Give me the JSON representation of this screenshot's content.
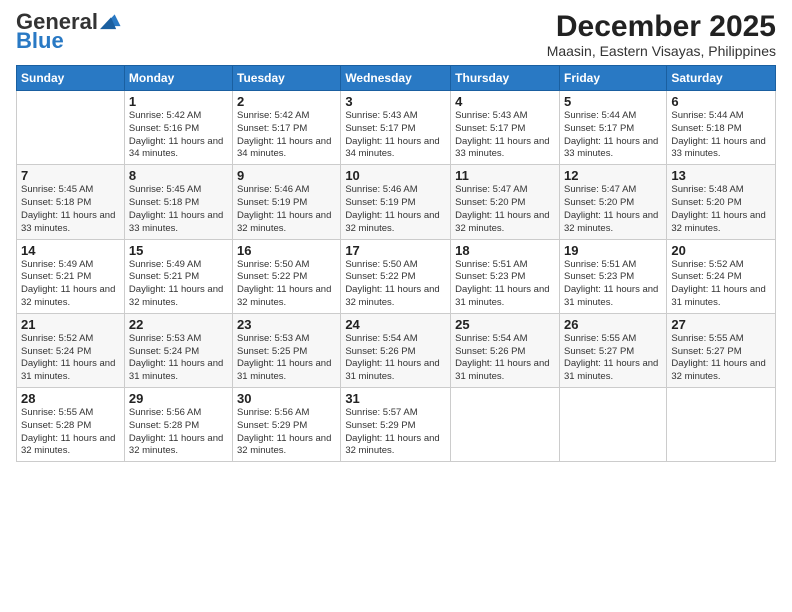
{
  "logo": {
    "general": "General",
    "blue": "Blue"
  },
  "title": "December 2025",
  "subtitle": "Maasin, Eastern Visayas, Philippines",
  "days_header": [
    "Sunday",
    "Monday",
    "Tuesday",
    "Wednesday",
    "Thursday",
    "Friday",
    "Saturday"
  ],
  "weeks": [
    [
      {
        "day": "",
        "info": ""
      },
      {
        "day": "1",
        "info": "Sunrise: 5:42 AM\nSunset: 5:16 PM\nDaylight: 11 hours and 34 minutes."
      },
      {
        "day": "2",
        "info": "Sunrise: 5:42 AM\nSunset: 5:17 PM\nDaylight: 11 hours and 34 minutes."
      },
      {
        "day": "3",
        "info": "Sunrise: 5:43 AM\nSunset: 5:17 PM\nDaylight: 11 hours and 34 minutes."
      },
      {
        "day": "4",
        "info": "Sunrise: 5:43 AM\nSunset: 5:17 PM\nDaylight: 11 hours and 33 minutes."
      },
      {
        "day": "5",
        "info": "Sunrise: 5:44 AM\nSunset: 5:17 PM\nDaylight: 11 hours and 33 minutes."
      },
      {
        "day": "6",
        "info": "Sunrise: 5:44 AM\nSunset: 5:18 PM\nDaylight: 11 hours and 33 minutes."
      }
    ],
    [
      {
        "day": "7",
        "info": "Sunrise: 5:45 AM\nSunset: 5:18 PM\nDaylight: 11 hours and 33 minutes."
      },
      {
        "day": "8",
        "info": "Sunrise: 5:45 AM\nSunset: 5:18 PM\nDaylight: 11 hours and 33 minutes."
      },
      {
        "day": "9",
        "info": "Sunrise: 5:46 AM\nSunset: 5:19 PM\nDaylight: 11 hours and 32 minutes."
      },
      {
        "day": "10",
        "info": "Sunrise: 5:46 AM\nSunset: 5:19 PM\nDaylight: 11 hours and 32 minutes."
      },
      {
        "day": "11",
        "info": "Sunrise: 5:47 AM\nSunset: 5:20 PM\nDaylight: 11 hours and 32 minutes."
      },
      {
        "day": "12",
        "info": "Sunrise: 5:47 AM\nSunset: 5:20 PM\nDaylight: 11 hours and 32 minutes."
      },
      {
        "day": "13",
        "info": "Sunrise: 5:48 AM\nSunset: 5:20 PM\nDaylight: 11 hours and 32 minutes."
      }
    ],
    [
      {
        "day": "14",
        "info": "Sunrise: 5:49 AM\nSunset: 5:21 PM\nDaylight: 11 hours and 32 minutes."
      },
      {
        "day": "15",
        "info": "Sunrise: 5:49 AM\nSunset: 5:21 PM\nDaylight: 11 hours and 32 minutes."
      },
      {
        "day": "16",
        "info": "Sunrise: 5:50 AM\nSunset: 5:22 PM\nDaylight: 11 hours and 32 minutes."
      },
      {
        "day": "17",
        "info": "Sunrise: 5:50 AM\nSunset: 5:22 PM\nDaylight: 11 hours and 32 minutes."
      },
      {
        "day": "18",
        "info": "Sunrise: 5:51 AM\nSunset: 5:23 PM\nDaylight: 11 hours and 31 minutes."
      },
      {
        "day": "19",
        "info": "Sunrise: 5:51 AM\nSunset: 5:23 PM\nDaylight: 11 hours and 31 minutes."
      },
      {
        "day": "20",
        "info": "Sunrise: 5:52 AM\nSunset: 5:24 PM\nDaylight: 11 hours and 31 minutes."
      }
    ],
    [
      {
        "day": "21",
        "info": "Sunrise: 5:52 AM\nSunset: 5:24 PM\nDaylight: 11 hours and 31 minutes."
      },
      {
        "day": "22",
        "info": "Sunrise: 5:53 AM\nSunset: 5:24 PM\nDaylight: 11 hours and 31 minutes."
      },
      {
        "day": "23",
        "info": "Sunrise: 5:53 AM\nSunset: 5:25 PM\nDaylight: 11 hours and 31 minutes."
      },
      {
        "day": "24",
        "info": "Sunrise: 5:54 AM\nSunset: 5:26 PM\nDaylight: 11 hours and 31 minutes."
      },
      {
        "day": "25",
        "info": "Sunrise: 5:54 AM\nSunset: 5:26 PM\nDaylight: 11 hours and 31 minutes."
      },
      {
        "day": "26",
        "info": "Sunrise: 5:55 AM\nSunset: 5:27 PM\nDaylight: 11 hours and 31 minutes."
      },
      {
        "day": "27",
        "info": "Sunrise: 5:55 AM\nSunset: 5:27 PM\nDaylight: 11 hours and 32 minutes."
      }
    ],
    [
      {
        "day": "28",
        "info": "Sunrise: 5:55 AM\nSunset: 5:28 PM\nDaylight: 11 hours and 32 minutes."
      },
      {
        "day": "29",
        "info": "Sunrise: 5:56 AM\nSunset: 5:28 PM\nDaylight: 11 hours and 32 minutes."
      },
      {
        "day": "30",
        "info": "Sunrise: 5:56 AM\nSunset: 5:29 PM\nDaylight: 11 hours and 32 minutes."
      },
      {
        "day": "31",
        "info": "Sunrise: 5:57 AM\nSunset: 5:29 PM\nDaylight: 11 hours and 32 minutes."
      },
      {
        "day": "",
        "info": ""
      },
      {
        "day": "",
        "info": ""
      },
      {
        "day": "",
        "info": ""
      }
    ]
  ]
}
